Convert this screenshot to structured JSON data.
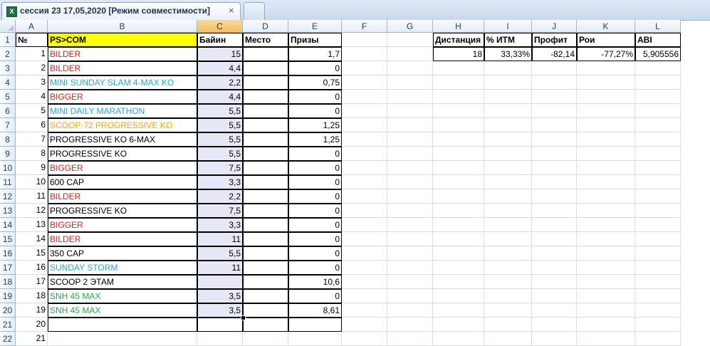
{
  "tab": {
    "title": "сессия 23 17,05,2020  [Режим совместимости]",
    "close": "×",
    "icon": "excel-file-icon"
  },
  "columns": [
    "A",
    "B",
    "C",
    "D",
    "E",
    "F",
    "G",
    "H",
    "I",
    "J",
    "K",
    "L"
  ],
  "header": {
    "num": "№",
    "name": "PS>COM",
    "buyin": "Байин",
    "place": "Место",
    "prize": "Призы"
  },
  "rows": [
    {
      "num": "1",
      "name": "BILDER",
      "color": "red",
      "buyin": "15",
      "prize": "1,7"
    },
    {
      "num": "2",
      "name": "BILDER",
      "color": "red",
      "buyin": "4,4",
      "prize": "0"
    },
    {
      "num": "3",
      "name": "MINI SUNDAY SLAM 4-MAX KO",
      "color": "blue",
      "buyin": "2,2",
      "prize": "0,75"
    },
    {
      "num": "4",
      "name": "BIGGER",
      "color": "red",
      "buyin": "4,4",
      "prize": "0"
    },
    {
      "num": "5",
      "name": "MINI DAILY MARATHON",
      "color": "blue",
      "buyin": "5,5",
      "prize": "0"
    },
    {
      "num": "6",
      "name": "SCOOP-72 PROGRESSIVE KO",
      "color": "orange",
      "buyin": "5,5",
      "prize": "1,25"
    },
    {
      "num": "7",
      "name": "PROGRESSIVE KO 6-MAX",
      "color": "black",
      "buyin": "5,5",
      "prize": "1,25"
    },
    {
      "num": "8",
      "name": "PROGRESSIVE KO",
      "color": "black",
      "buyin": "5,5",
      "prize": "0"
    },
    {
      "num": "9",
      "name": "BIGGER",
      "color": "red",
      "buyin": "7,5",
      "prize": "0"
    },
    {
      "num": "10",
      "name": "600 CAP",
      "color": "black",
      "buyin": "3,3",
      "prize": "0"
    },
    {
      "num": "11",
      "name": "BILDER",
      "color": "red",
      "buyin": "2,2",
      "prize": "0"
    },
    {
      "num": "12",
      "name": "PROGRESSIVE KO",
      "color": "black",
      "buyin": "7,5",
      "prize": "0"
    },
    {
      "num": "13",
      "name": "BIGGER",
      "color": "red",
      "buyin": "3,3",
      "prize": "0"
    },
    {
      "num": "14",
      "name": "BILDER",
      "color": "red",
      "buyin": "11",
      "prize": "0"
    },
    {
      "num": "15",
      "name": "350 CAP",
      "color": "black",
      "buyin": "5,5",
      "prize": "0"
    },
    {
      "num": "16",
      "name": "SUNDAY STORM",
      "color": "blue",
      "buyin": "11",
      "prize": "0"
    },
    {
      "num": "17",
      "name": "SCOOP 2 ЭТАМ",
      "color": "black",
      "buyin": "",
      "prize": "10,6"
    },
    {
      "num": "18",
      "name": "SNH 45 MAX",
      "color": "green",
      "buyin": "3,5",
      "prize": "0"
    },
    {
      "num": "19",
      "name": "SNH 45 MAX",
      "color": "green",
      "buyin": "3,5",
      "prize": "8,61"
    },
    {
      "num": "20",
      "name": "",
      "color": "black",
      "buyin": "",
      "prize": ""
    },
    {
      "num": "21",
      "name": "",
      "color": "black",
      "buyin": "",
      "prize": ""
    }
  ],
  "stats": {
    "labels": [
      "Дистанция",
      "% ИТМ",
      "Профит",
      "Рои",
      "ABI"
    ],
    "values": [
      "18",
      "33,33%",
      "-82,14",
      "-77,27%",
      "5,905556"
    ]
  },
  "colors": {
    "red": "#e31d1d",
    "blue": "#2aa4d6",
    "orange": "#f7a600",
    "green": "#25a84a",
    "header_fill": "#ffff00",
    "selection": "#f1c15f"
  }
}
